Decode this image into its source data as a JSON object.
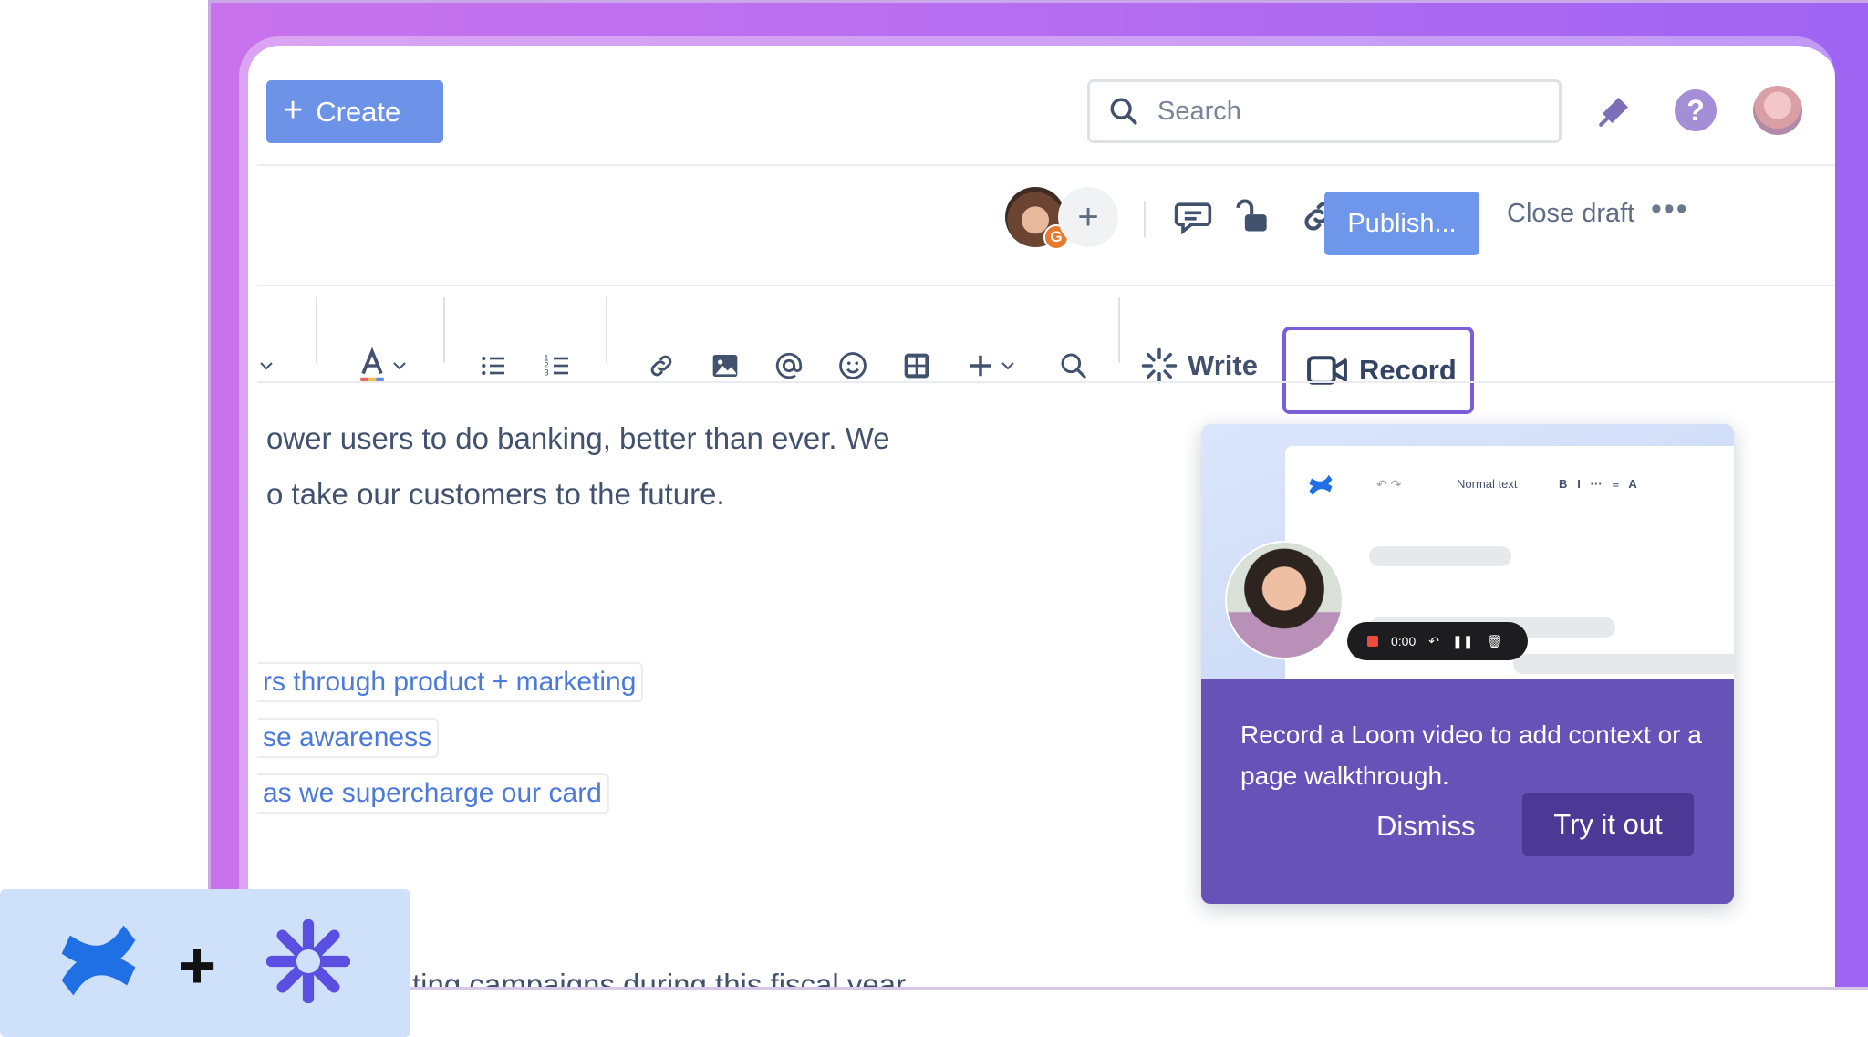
{
  "header": {
    "create_label": "Create",
    "search_placeholder": "Search"
  },
  "page_actions": {
    "collaborator_badge": "G",
    "publish_label": "Publish...",
    "close_draft_label": "Close draft",
    "more_label": "•••"
  },
  "toolbar": {
    "write_label": "Write",
    "record_label": "Record"
  },
  "content": {
    "line1": "ower users to do banking, better than ever. We",
    "line2": "o take our customers to the future.",
    "link1": "rs through product + marketing",
    "link2": "se awareness",
    "link3": "as we supercharge our card",
    "line_bottom": "ting campaigns during this fiscal year"
  },
  "popup": {
    "mini_toolbar_style": "Normal text",
    "timer": "0:00",
    "message": "Record a Loom video to add context or a page walkthrough.",
    "dismiss_label": "Dismiss",
    "try_label": "Try it out"
  },
  "colors": {
    "primary_blue": "#6d93e8",
    "loom_purple": "#6753b8",
    "frame_gradient_start": "#c873ec",
    "frame_gradient_end": "#9f64f2"
  },
  "icons": [
    "plus-icon",
    "search-icon",
    "notification-icon",
    "help-icon",
    "comment-icon",
    "restrictions-icon",
    "link-icon",
    "more-icon",
    "text-color-icon",
    "bullet-list-icon",
    "numbered-list-icon",
    "image-icon",
    "mention-icon",
    "emoji-icon",
    "table-icon",
    "insert-icon",
    "find-icon",
    "ai-write-icon",
    "video-icon",
    "confluence-logo",
    "loom-logo"
  ]
}
